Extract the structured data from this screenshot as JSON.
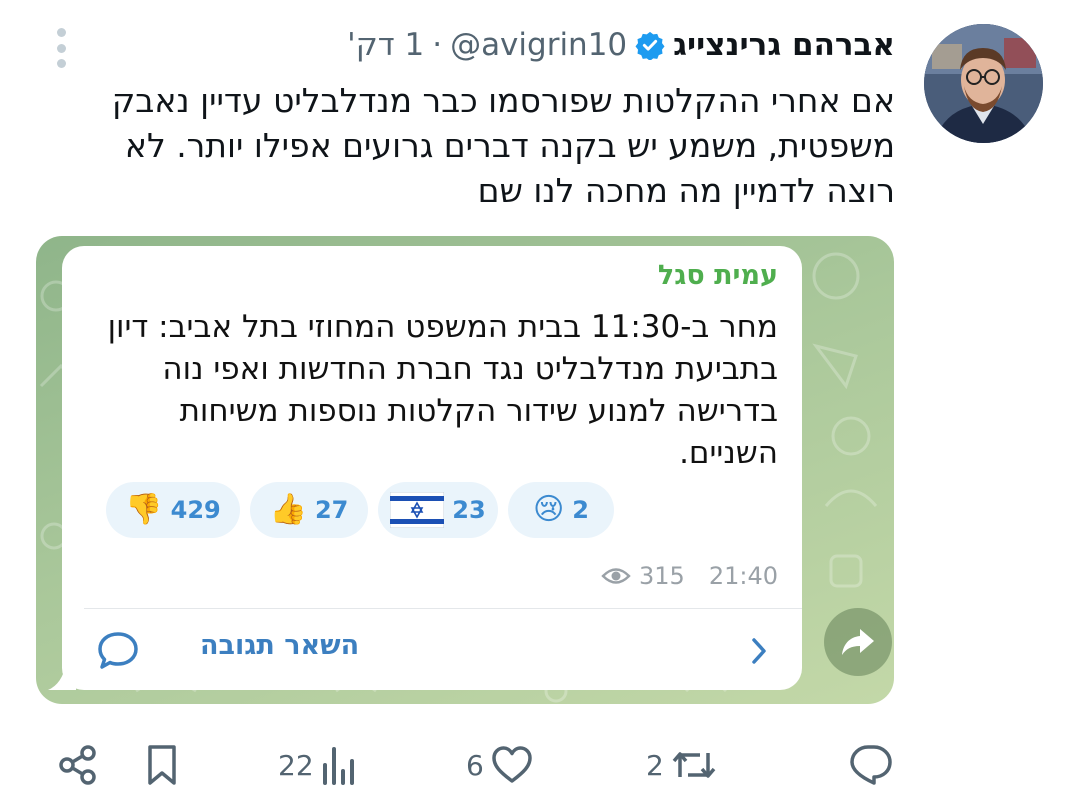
{
  "author": {
    "display_name": "אברהם גרינצייג",
    "handle": "@avigrin10",
    "separator": "·",
    "time_ago": "1 דק'"
  },
  "tweet": {
    "text": "אם אחרי ההקלטות שפורסמו כבר מנדלבליט עדיין נאבק משפטית, משמע יש בקנה דברים גרועים אפילו יותר. לא רוצה לדמיין מה מחכה לנו שם"
  },
  "telegram": {
    "sender": "עמית סגל",
    "message": "מחר ב-11:30 בבית המשפט המחוזי בתל אביב: דיון בתביעת מנדלבליט נגד חברת החדשות ואפי נוה בדרישה למנוע שידור הקלטות נוספות משיחות השניים.",
    "reactions": [
      {
        "emoji": "👎",
        "count": "429",
        "icon": "thumbs-down-icon"
      },
      {
        "emoji": "👍",
        "count": "27",
        "icon": "thumbs-up-icon"
      },
      {
        "emoji": "flag",
        "count": "23",
        "icon": "israel-flag-icon"
      },
      {
        "emoji": "😢",
        "count": "2",
        "icon": "crying-face-icon"
      }
    ],
    "views": "315",
    "time": "21:40",
    "reply_label": "השאר תגובה"
  },
  "actions": {
    "replies": "",
    "retweets": "2",
    "likes": "6",
    "views": "22"
  },
  "colors": {
    "accent_blue": "#1d9bf0",
    "telegram_green": "#4fae4e",
    "telegram_link": "#3c7fc0",
    "muted": "#536471"
  }
}
